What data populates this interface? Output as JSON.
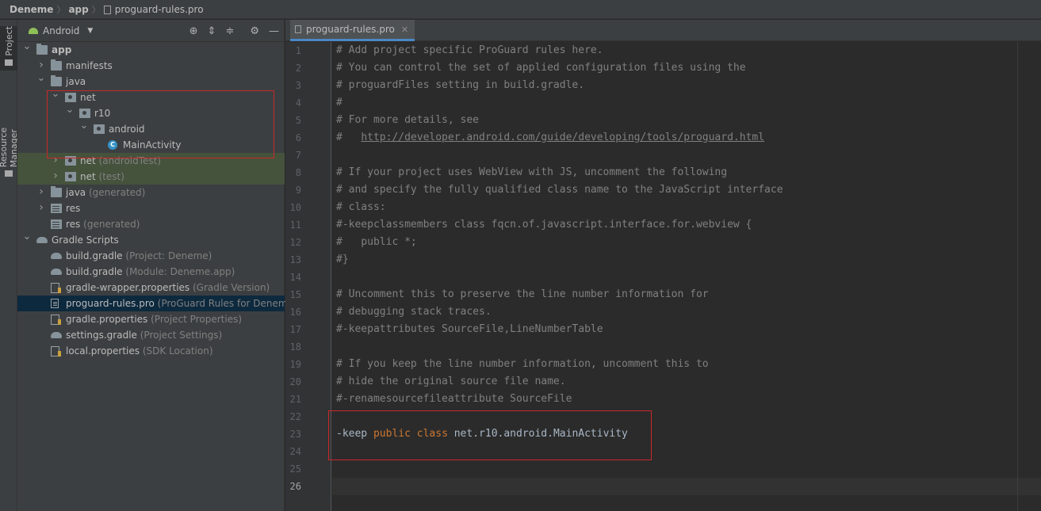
{
  "breadcrumb": {
    "project": "Deneme",
    "module": "app",
    "file": "proguard-rules.pro"
  },
  "toolstrip": {
    "project_tab": "Project",
    "resource_tab": "Resource Manager"
  },
  "project_panel": {
    "view_label": "Android",
    "header_icons": [
      "locate-icon",
      "expand-all-icon",
      "collapse-all-icon",
      "gear-icon",
      "minimize-icon"
    ],
    "tree": [
      {
        "label": "app",
        "hint": "",
        "icon": "module-folder-icon",
        "level": 0,
        "expanded": true,
        "bold": true
      },
      {
        "label": "manifests",
        "hint": "",
        "icon": "folder-icon",
        "level": 1,
        "expanded": false
      },
      {
        "label": "java",
        "hint": "",
        "icon": "folder-icon",
        "level": 1,
        "expanded": true
      },
      {
        "label": "net",
        "hint": "",
        "icon": "package-icon",
        "level": 2,
        "expanded": true
      },
      {
        "label": "r10",
        "hint": "",
        "icon": "package-icon",
        "level": 3,
        "expanded": true
      },
      {
        "label": "android",
        "hint": "",
        "icon": "package-icon",
        "level": 4,
        "expanded": true
      },
      {
        "label": "MainActivity",
        "hint": "",
        "icon": "class-icon",
        "level": 5,
        "expanded": null
      },
      {
        "label": "net",
        "hint": "(androidTest)",
        "icon": "package-icon",
        "level": 2,
        "expanded": false,
        "highlight": true
      },
      {
        "label": "net",
        "hint": "(test)",
        "icon": "package-icon",
        "level": 2,
        "expanded": false,
        "highlight": true
      },
      {
        "label": "java",
        "hint": "(generated)",
        "icon": "generated-folder-icon",
        "level": 1,
        "expanded": false
      },
      {
        "label": "res",
        "hint": "",
        "icon": "resources-icon",
        "level": 1,
        "expanded": false
      },
      {
        "label": "res",
        "hint": "(generated)",
        "icon": "resources-icon",
        "level": 1,
        "expanded": null
      },
      {
        "label": "Gradle Scripts",
        "hint": "",
        "icon": "gradle-icon",
        "level": 0,
        "expanded": true
      },
      {
        "label": "build.gradle",
        "hint": "(Project: Deneme)",
        "icon": "gradle-icon",
        "level": 1,
        "expanded": null
      },
      {
        "label": "build.gradle",
        "hint": "(Module: Deneme.app)",
        "icon": "gradle-icon",
        "level": 1,
        "expanded": null
      },
      {
        "label": "gradle-wrapper.properties",
        "hint": "(Gradle Version)",
        "icon": "properties-icon",
        "level": 1,
        "expanded": null
      },
      {
        "label": "proguard-rules.pro",
        "hint": "(ProGuard Rules for Deneme.app)",
        "icon": "file-icon",
        "level": 1,
        "expanded": null,
        "selected": true
      },
      {
        "label": "gradle.properties",
        "hint": "(Project Properties)",
        "icon": "properties-icon",
        "level": 1,
        "expanded": null
      },
      {
        "label": "settings.gradle",
        "hint": "(Project Settings)",
        "icon": "gradle-icon",
        "level": 1,
        "expanded": null
      },
      {
        "label": "local.properties",
        "hint": "(SDK Location)",
        "icon": "properties-icon",
        "level": 1,
        "expanded": null
      }
    ]
  },
  "editor": {
    "tab_label": "proguard-rules.pro",
    "current_line": 26,
    "lines": [
      {
        "n": "1",
        "text": "# Add project specific ProGuard rules here."
      },
      {
        "n": "2",
        "text": "# You can control the set of applied configuration files using the"
      },
      {
        "n": "3",
        "text": "# proguardFiles setting in build.gradle."
      },
      {
        "n": "4",
        "text": "#"
      },
      {
        "n": "5",
        "text": "# For more details, see"
      },
      {
        "n": "6",
        "text": "#   http://developer.android.com/guide/developing/tools/proguard.html"
      },
      {
        "n": "7",
        "text": ""
      },
      {
        "n": "8",
        "text": "# If your project uses WebView with JS, uncomment the following"
      },
      {
        "n": "9",
        "text": "# and specify the fully qualified class name to the JavaScript interface"
      },
      {
        "n": "10",
        "text": "# class:"
      },
      {
        "n": "11",
        "text": "#-keepclassmembers class fqcn.of.javascript.interface.for.webview {"
      },
      {
        "n": "12",
        "text": "#   public *;"
      },
      {
        "n": "13",
        "text": "#}"
      },
      {
        "n": "14",
        "text": ""
      },
      {
        "n": "15",
        "text": "# Uncomment this to preserve the line number information for"
      },
      {
        "n": "16",
        "text": "# debugging stack traces."
      },
      {
        "n": "17",
        "text": "#-keepattributes SourceFile,LineNumberTable"
      },
      {
        "n": "18",
        "text": ""
      },
      {
        "n": "19",
        "text": "# If you keep the line number information, uncomment this to"
      },
      {
        "n": "20",
        "text": "# hide the original source file name."
      },
      {
        "n": "21",
        "text": "#-renamesourcefileattribute SourceFile"
      },
      {
        "n": "22",
        "text": ""
      },
      {
        "n": "23",
        "text": "-keep public class net.r10.android.MainActivity"
      },
      {
        "n": "24",
        "text": ""
      },
      {
        "n": "25",
        "text": ""
      },
      {
        "n": "26",
        "text": ""
      }
    ]
  },
  "colors": {
    "comment": "#808080",
    "keyword": "#cc7832",
    "plain": "#a9b7c6",
    "highlight_box": "#c8282a",
    "selection": "#0d293e"
  }
}
